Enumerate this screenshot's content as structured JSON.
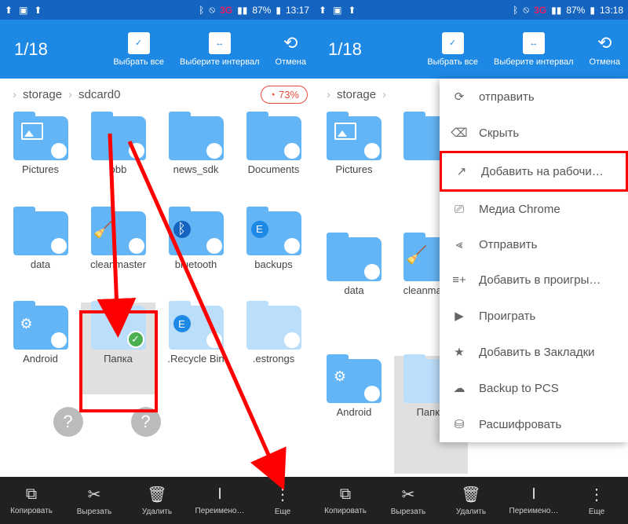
{
  "statusbar": {
    "network": "3G",
    "battery": "87%",
    "time_left": "13:17",
    "time_right": "13:18"
  },
  "toolbar": {
    "count": "1/18",
    "select_all": "Выбрать все",
    "select_range": "Выберите интервал",
    "cancel": "Отмена"
  },
  "breadcrumb": {
    "root": "storage",
    "current": "sdcard0",
    "storage_pct": "73%"
  },
  "folders_left": [
    {
      "label": "Pictures",
      "type": "img"
    },
    {
      "label": "obb"
    },
    {
      "label": "news_sdk"
    },
    {
      "label": "Documents"
    },
    {
      "label": "data"
    },
    {
      "label": "cleanmaster",
      "badge": "broom"
    },
    {
      "label": "bluetooth",
      "badge": "bt"
    },
    {
      "label": "backups",
      "badge": "es"
    },
    {
      "label": "Android",
      "badge": "gear"
    },
    {
      "label": "Папка",
      "selected": true,
      "light": true
    },
    {
      "label": ".Recycle Bin",
      "light": true,
      "badge": "es"
    },
    {
      "label": ".estrongs",
      "light": true
    },
    {
      "label": "",
      "type": "q"
    },
    {
      "label": "",
      "type": "q"
    }
  ],
  "folders_right": [
    {
      "label": "Pictures",
      "type": "img"
    },
    {
      "label": ""
    },
    {
      "label": "data"
    },
    {
      "label": "cleanmaster",
      "badge": "broom"
    },
    {
      "label": "Android",
      "badge": "gear"
    },
    {
      "label": "Папка",
      "selected": true,
      "light": true
    }
  ],
  "bottombar": {
    "copy": "Копировать",
    "cut": "Вырезать",
    "delete": "Удалить",
    "rename": "Переимено…",
    "more": "Еще"
  },
  "menu": {
    "send": "отправить",
    "hide": "Скрыть",
    "add_desktop": "Добавить на рабочи…",
    "media_chrome": "Медиа Chrome",
    "share": "Отправить",
    "add_playlist": "Добавить в проигры…",
    "play": "Проиграть",
    "bookmark": "Добавить в Закладки",
    "backup": "Backup to PCS",
    "decrypt": "Расшифровать"
  }
}
